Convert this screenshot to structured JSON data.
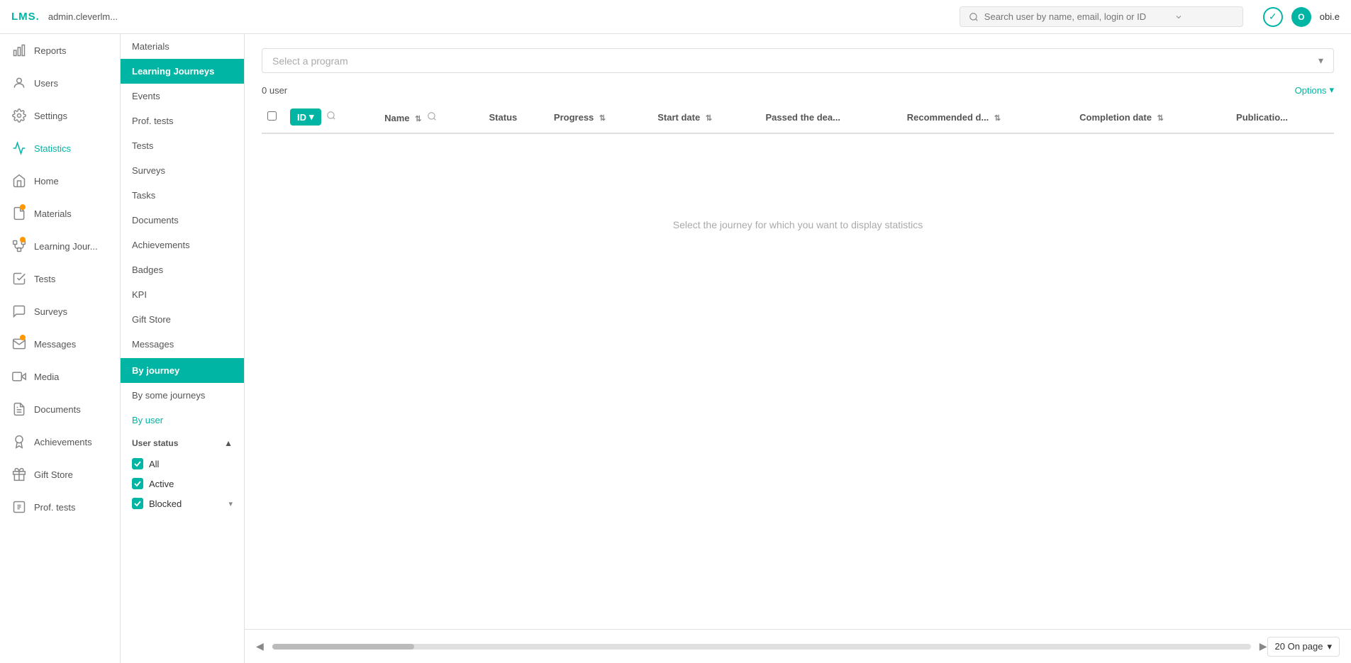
{
  "topbar": {
    "logo": "LMS.",
    "admin": "admin.cleverlm...",
    "search_placeholder": "Search user by name, email, login or ID",
    "check_icon": "✓",
    "avatar_initials": "O",
    "username": "obi.e"
  },
  "sidebar_primary": {
    "items": [
      {
        "id": "reports",
        "label": "Reports",
        "icon": "chart",
        "active": false,
        "dot": false
      },
      {
        "id": "users",
        "label": "Users",
        "icon": "user",
        "active": false,
        "dot": false
      },
      {
        "id": "settings",
        "label": "Settings",
        "icon": "gear",
        "active": false,
        "dot": false
      },
      {
        "id": "statistics",
        "label": "Statistics",
        "icon": "stats",
        "active": true,
        "dot": false
      },
      {
        "id": "home",
        "label": "Home",
        "icon": "home",
        "active": false,
        "dot": false
      },
      {
        "id": "materials",
        "label": "Materials",
        "icon": "material",
        "active": false,
        "dot": true
      },
      {
        "id": "learning-journeys",
        "label": "Learning Jour...",
        "icon": "journey",
        "active": false,
        "dot": true
      },
      {
        "id": "tests",
        "label": "Tests",
        "icon": "tests",
        "active": false,
        "dot": false
      },
      {
        "id": "surveys",
        "label": "Surveys",
        "icon": "surveys",
        "active": false,
        "dot": false
      },
      {
        "id": "messages",
        "label": "Messages",
        "icon": "messages",
        "active": false,
        "dot": true
      },
      {
        "id": "media",
        "label": "Media",
        "icon": "media",
        "active": false,
        "dot": false
      },
      {
        "id": "documents",
        "label": "Documents",
        "icon": "documents",
        "active": false,
        "dot": false
      },
      {
        "id": "achievements",
        "label": "Achievements",
        "icon": "achievements",
        "active": false,
        "dot": false
      },
      {
        "id": "gift-store",
        "label": "Gift Store",
        "icon": "gift",
        "active": false,
        "dot": false
      },
      {
        "id": "prof-tests",
        "label": "Prof. tests",
        "icon": "prof-tests",
        "active": false,
        "dot": false
      }
    ]
  },
  "sidebar_secondary": {
    "items": [
      {
        "id": "materials",
        "label": "Materials",
        "active": false
      },
      {
        "id": "learning-journeys",
        "label": "Learning Journeys",
        "active": true
      },
      {
        "id": "events",
        "label": "Events",
        "active": false
      },
      {
        "id": "prof-tests",
        "label": "Prof. tests",
        "active": false
      },
      {
        "id": "tests",
        "label": "Tests",
        "active": false
      },
      {
        "id": "surveys",
        "label": "Surveys",
        "active": false
      },
      {
        "id": "tasks",
        "label": "Tasks",
        "active": false
      },
      {
        "id": "documents",
        "label": "Documents",
        "active": false
      },
      {
        "id": "achievements",
        "label": "Achievements",
        "active": false
      },
      {
        "id": "badges",
        "label": "Badges",
        "active": false
      },
      {
        "id": "kpi",
        "label": "KPI",
        "active": false
      },
      {
        "id": "gift-store",
        "label": "Gift Store",
        "active": false
      },
      {
        "id": "messages",
        "label": "Messages",
        "active": false
      }
    ],
    "sub_sections": [
      {
        "id": "by-journey",
        "label": "By journey",
        "active": true
      },
      {
        "id": "by-some-journeys",
        "label": "By some journeys",
        "active": false
      },
      {
        "id": "by-user",
        "label": "By user",
        "active": false,
        "teal": true
      }
    ],
    "user_status_label": "User status",
    "statuses": [
      {
        "id": "all",
        "label": "All",
        "checked": true
      },
      {
        "id": "active",
        "label": "Active",
        "checked": true
      },
      {
        "id": "blocked",
        "label": "Blocked",
        "checked": true,
        "has_arrow": true
      }
    ]
  },
  "content": {
    "select_program_placeholder": "Select a program",
    "user_count": "0 user",
    "options_label": "Options",
    "empty_message": "Select the journey for which you want to display statistics",
    "table": {
      "columns": [
        {
          "id": "id",
          "label": "ID",
          "sortable": true,
          "searchable": true
        },
        {
          "id": "name",
          "label": "Name",
          "sortable": true,
          "searchable": true
        },
        {
          "id": "status",
          "label": "Status",
          "sortable": false,
          "searchable": false
        },
        {
          "id": "progress",
          "label": "Progress",
          "sortable": true,
          "searchable": false
        },
        {
          "id": "start-date",
          "label": "Start date",
          "sortable": true,
          "searchable": false
        },
        {
          "id": "passed-deadline",
          "label": "Passed the dea...",
          "sortable": false,
          "searchable": false
        },
        {
          "id": "recommended-d",
          "label": "Recommended d...",
          "sortable": true,
          "searchable": false
        },
        {
          "id": "completion-date",
          "label": "Completion date",
          "sortable": true,
          "searchable": false
        },
        {
          "id": "publication",
          "label": "Publicatio...",
          "sortable": false,
          "searchable": false
        }
      ],
      "rows": []
    },
    "per_page": "20 On page",
    "per_page_arrow": "▾"
  }
}
